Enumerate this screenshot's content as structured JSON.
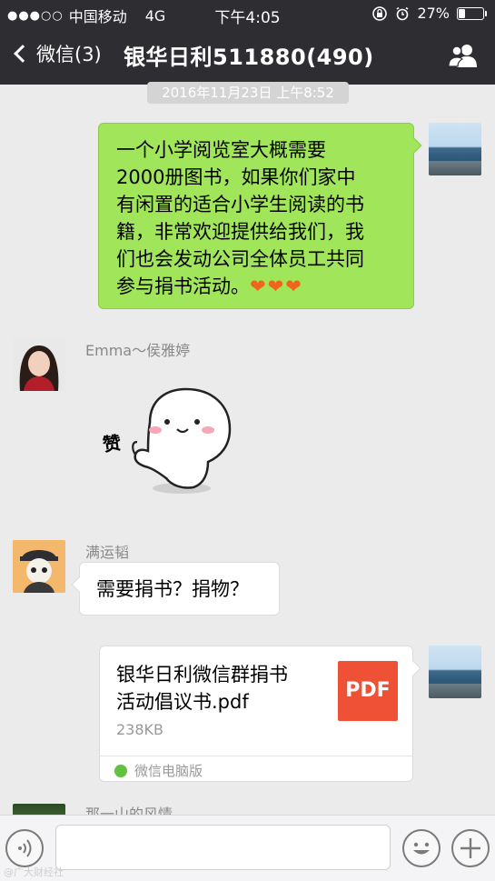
{
  "status_bar": {
    "signal_dots": "●●●○○",
    "carrier": "中国移动",
    "network": "4G",
    "time": "下午4:05",
    "battery_pct": "27%",
    "battery_level": 0.27
  },
  "nav": {
    "back_label": "微信(3)",
    "title": "银华日利511880(490)",
    "members_icon": "people-icon"
  },
  "timestamp": "2016年11月23日 上午8:52",
  "messages": [
    {
      "side": "right",
      "type": "text",
      "lines": [
        "一个小学阅览室大概需要",
        "2000册图书，如果你们家中",
        "有闲置的适合小学生阅读的书",
        "籍，非常欢迎提供给我们，我",
        "们也会发动公司全体员工共同",
        "参与捐书活动。"
      ],
      "emoji": "❤❤❤"
    },
    {
      "side": "left",
      "sender": "Emma～侯雅婷",
      "type": "sticker",
      "sticker_text": "赞"
    },
    {
      "side": "left",
      "sender": "满运韬",
      "type": "text",
      "text": "需要捐书？捐物？"
    },
    {
      "side": "right",
      "type": "file",
      "file_title": "银华日利微信群捐书活动倡议书.pdf",
      "file_title_lines": [
        "银华日利微信群捐书",
        "活动倡议书.pdf"
      ],
      "file_size": "238KB",
      "file_badge": "PDF",
      "source": "微信电脑版"
    },
    {
      "side": "left",
      "sender": "那一山的风情"
    }
  ],
  "watermark": "@广大财经社",
  "colors": {
    "header_bg": "#2e2e32",
    "chat_bg": "#ebebeb",
    "self_bubble": "#a0e55a",
    "pdf_badge": "#ef5136"
  }
}
